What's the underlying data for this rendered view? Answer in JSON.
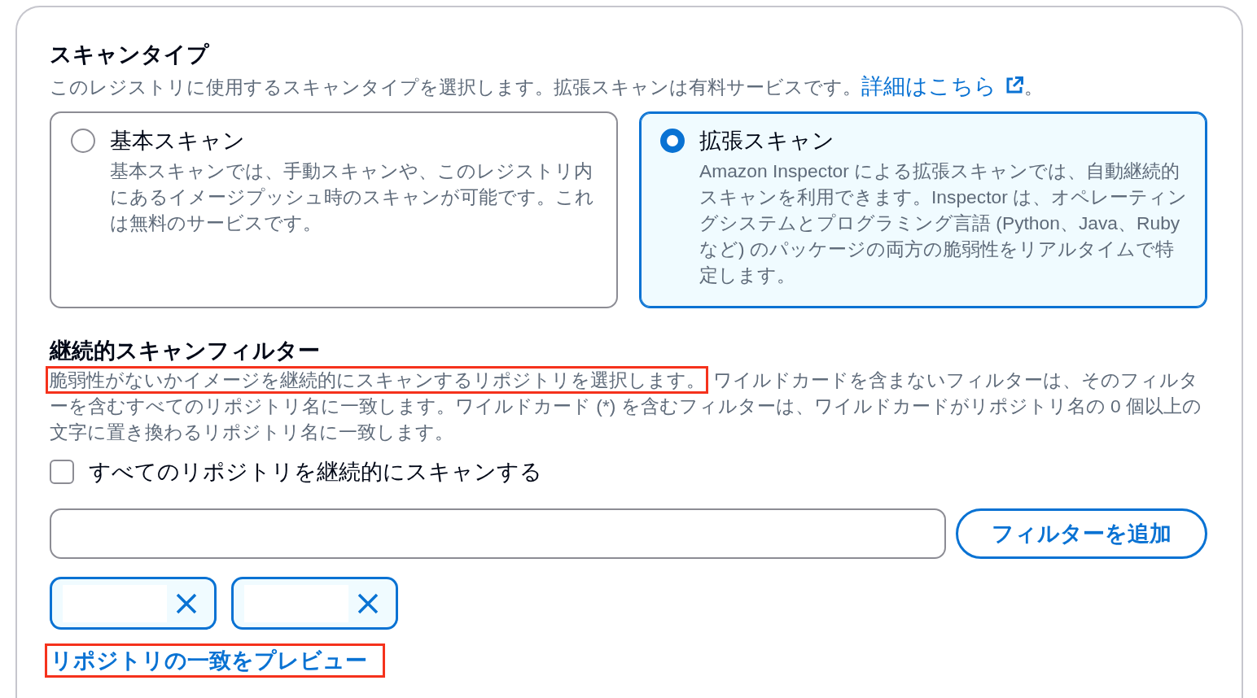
{
  "scan_type": {
    "title": "スキャンタイプ",
    "description": "このレジストリに使用するスキャンタイプを選択します。拡張スキャンは有料サービスです。",
    "link": "詳細はこちら",
    "description_end": "。",
    "options": [
      {
        "label": "基本スキャン",
        "description": "基本スキャンでは、手動スキャンや、このレジストリ内にあるイメージプッシュ時のスキャンが可能です。これは無料のサービスです。",
        "selected": false
      },
      {
        "label": "拡張スキャン",
        "description": "Amazon Inspector による拡張スキャンでは、自動継続的スキャンを利用できます。Inspector は、オペレーティングシステムとプログラミング言語 (Python、Java、Ruby など) のパッケージの両方の脆弱性をリアルタイムで特定します。",
        "selected": true
      }
    ]
  },
  "continuous_scan_filters": {
    "title": "継続的スキャンフィルター",
    "description": [
      {
        "text": "脆弱性がないかイメージを継続的にスキャンするリポジトリを選択します。",
        "highlighted": true
      },
      {
        "text": "ワイルドカードを含まないフィルターは、そのフィルターを含むすべてのリポジトリ名に一致します。ワイルドカード (*) を含むフィルターは、ワイルドカードがリポジトリ名の 0 個以上の文字に置き換わるリポジトリ名に一致します。",
        "highlighted": false
      }
    ],
    "scan_all_checkbox": {
      "label": "すべてのリポジトリを継続的にスキャンする",
      "checked": false
    },
    "add_filter_button": "フィルターを追加",
    "filter_tokens": [
      {
        "label_redacted": true
      },
      {
        "label_redacted": true
      }
    ],
    "preview_link": {
      "label": "リポジトリの一致をプレビュー",
      "highlighted": true
    }
  }
}
